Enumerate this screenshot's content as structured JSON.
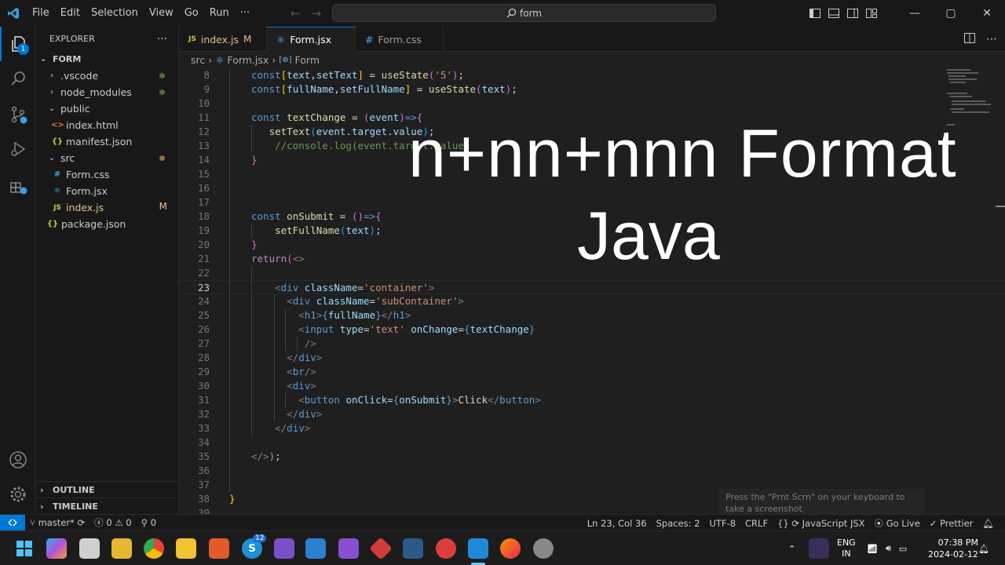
{
  "titlebar": {
    "menu": [
      "File",
      "Edit",
      "Selection",
      "View",
      "Go",
      "Run",
      "···"
    ],
    "search": "form",
    "win_min": "—",
    "win_max": "▢",
    "win_close": "✕"
  },
  "activity": {
    "explorer_badge": "1"
  },
  "explorer": {
    "title": "EXPLORER",
    "more": "···",
    "folder": "FORM",
    "items": [
      {
        "label": ".vscode",
        "type": "folder"
      },
      {
        "label": "node_modules",
        "type": "folder"
      },
      {
        "label": "public",
        "type": "folder-open"
      },
      {
        "label": "index.html",
        "icon": "<>"
      },
      {
        "label": "manifest.json",
        "icon": "{}"
      },
      {
        "label": "src",
        "type": "folder-open"
      },
      {
        "label": "Form.css",
        "icon": "#"
      },
      {
        "label": "Form.jsx",
        "icon": "⚛"
      },
      {
        "label": "index.js",
        "icon": "JS",
        "status": "M"
      },
      {
        "label": "package.json",
        "icon": "{}"
      }
    ],
    "outline": "OUTLINE",
    "timeline": "TIMELINE"
  },
  "tabs": [
    {
      "label": "index.js",
      "status": "M",
      "icon": "JS"
    },
    {
      "label": "Form.jsx",
      "icon": "⚛"
    },
    {
      "label": "Form.css",
      "icon": "#"
    }
  ],
  "breadcrumb": {
    "src": "src",
    "file": "Form.jsx",
    "symbol": "Form",
    "sep": "›"
  },
  "editor": {
    "line_numbers": [
      "8",
      "9",
      "10",
      "11",
      "12",
      "13",
      "14",
      "15",
      "16",
      "17",
      "18",
      "19",
      "20",
      "21",
      "22",
      "23",
      "24",
      "25",
      "26",
      "27",
      "28",
      "29",
      "30",
      "31",
      "32",
      "33",
      "34",
      "35",
      "36",
      "37",
      "38",
      "39"
    ]
  },
  "overlay": {
    "line1": "n+nn+nnn Format",
    "line2": "Java"
  },
  "tooltip": "Press the \"Prnt Scrn\" on your keyboard to take a screenshot",
  "statusbar": {
    "branch": "master*",
    "problems": "0",
    "warnings": "0",
    "ports": "0",
    "position": "Ln 23, Col 36",
    "spaces": "Spaces: 2",
    "encoding": "UTF-8",
    "eol": "CRLF",
    "language": "JavaScript JSX",
    "golive": "Go Live",
    "prettier": "Prettier"
  },
  "taskbar": {
    "lang": "ENG",
    "region": "IN",
    "time": "07:38 PM",
    "date": "2024-02-12",
    "skype_badge": "12"
  },
  "colors": {
    "accent": "#0078d4",
    "editor_bg": "#1f1f1f",
    "modified": "#e2c08d"
  }
}
